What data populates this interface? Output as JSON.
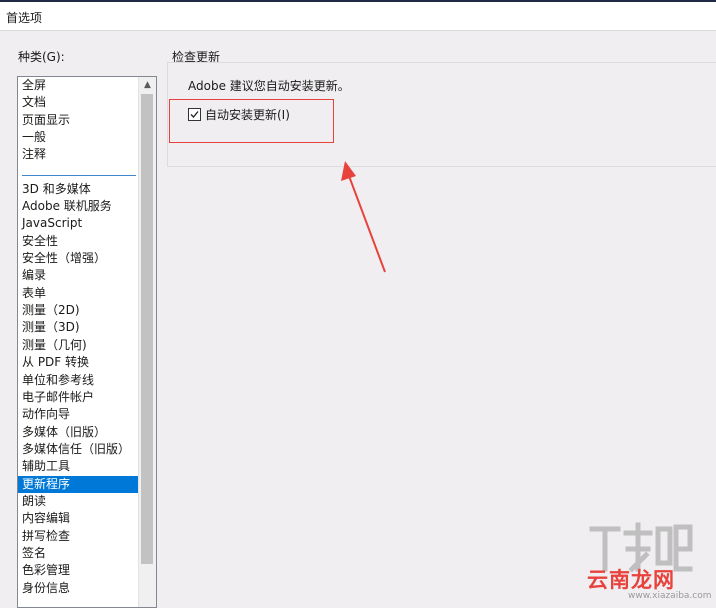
{
  "window": {
    "title": "首选项"
  },
  "categories": {
    "label": "种类(G):",
    "top_items": [
      "全屏",
      "文档",
      "页面显示",
      "一般",
      "注释"
    ],
    "items": [
      "3D 和多媒体",
      "Adobe 联机服务",
      "JavaScript",
      "安全性",
      "安全性（增强）",
      "编录",
      "表单",
      "测量（2D)",
      "测量（3D)",
      "测量（几何)",
      "从 PDF 转换",
      "单位和参考线",
      "电子邮件帐户",
      "动作向导",
      "多媒体（旧版）",
      "多媒体信任（旧版）",
      "辅助工具",
      "更新程序",
      "朗读",
      "内容编辑",
      "拼写检查",
      "签名",
      "色彩管理",
      "身份信息"
    ],
    "selected": "更新程序"
  },
  "update_section": {
    "group_label": "检查更新",
    "description": "Adobe 建议您自动安装更新。",
    "checkbox_label": "自动安装更新(I)",
    "checkbox_checked": true
  },
  "watermark": {
    "brand": "云南龙网",
    "url": "www.xiazaiba.com"
  },
  "colors": {
    "annotation": "#e8423d",
    "selection": "#0078d7"
  }
}
